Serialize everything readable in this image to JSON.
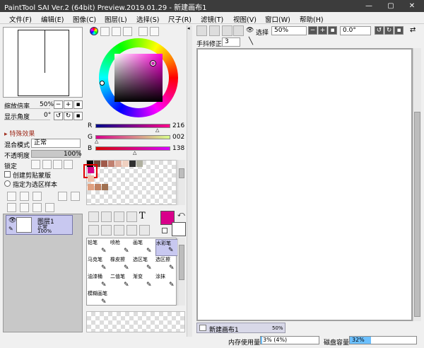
{
  "window": {
    "title": "PaintTool SAI Ver.2 (64bit) Preview.2019.01.29 - 新建画布1",
    "btn_min": "—",
    "btn_max": "▢",
    "btn_close": "✕"
  },
  "menu": [
    "文件(F)",
    "编辑(E)",
    "图像(C)",
    "图层(L)",
    "选择(S)",
    "尺子(R)",
    "滤镜(T)",
    "视图(V)",
    "窗口(W)",
    "帮助(H)"
  ],
  "navigator": {
    "zoom_label": "缩放倍率",
    "zoom_value": "50%",
    "angle_label": "显示角度",
    "angle_value": "0°"
  },
  "layer_props": {
    "section": "▸ 特殊效果",
    "blend_label": "混合模式",
    "blend_value": "正常",
    "opacity_label": "不透明度",
    "opacity_value": "100%",
    "lock_label": "锁定",
    "clip_label": "创建剪贴蒙版",
    "sel_sample_label": "指定为选区样本"
  },
  "layer": {
    "name": "图层1",
    "mode": "正常",
    "opacity": "100%"
  },
  "color": {
    "r_label": "R",
    "r": "216",
    "g_label": "G",
    "g": "002",
    "b_label": "B",
    "b": "138",
    "current": "#d8008a"
  },
  "swatches_row1": [
    "#000000",
    "#6e4a3a",
    "#a05a4a",
    "#c08070",
    "#e0b0a0",
    "#f0d0c0",
    "#303030",
    "#b0b0a0"
  ],
  "swatches_user": [
    "#d8008a",
    "#f0c0a8",
    "#e0a080",
    "#c08060",
    "#a07050"
  ],
  "brushes": [
    {
      "name": "铅笔",
      "icon": "pencil"
    },
    {
      "name": "喷枪",
      "icon": "airbrush"
    },
    {
      "name": "画笔",
      "icon": "brush"
    },
    {
      "name": "水彩笔",
      "icon": "watercolor"
    },
    {
      "name": "马克笔",
      "icon": "marker"
    },
    {
      "name": "橡皮擦",
      "icon": "eraser"
    },
    {
      "name": "选区笔",
      "icon": "selpen"
    },
    {
      "name": "选区擦",
      "icon": "selerase"
    },
    {
      "name": "油漆桶",
      "icon": "bucket"
    },
    {
      "name": "二值笔",
      "icon": "binary"
    },
    {
      "name": "渐变",
      "icon": "gradient"
    },
    {
      "name": "涂抹",
      "icon": "blur"
    },
    {
      "name": "模糊画笔",
      "icon": "blurbrush"
    }
  ],
  "toolbar": {
    "select_label": "选择",
    "zoom_value": "50%",
    "rotate_value": "0.0°",
    "stab_label": "手抖修正",
    "stab_value": "3"
  },
  "canvas_tab": {
    "name": "新建画布1",
    "zoom": "50%"
  },
  "status": {
    "mem_label": "内存使用量",
    "mem_value": "3% (4%)",
    "mem_pct": 0.03,
    "disk_label": "磁盘容量",
    "disk_value": "32%",
    "disk_pct": 0.32
  }
}
